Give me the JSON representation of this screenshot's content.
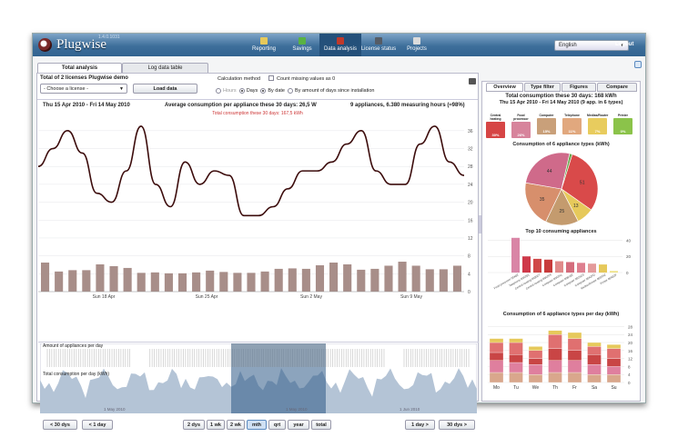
{
  "app": {
    "name": "Plugwise",
    "version": "1.4.0.1031"
  },
  "nav": [
    {
      "label": "Reporting",
      "icon": "reporting-icon",
      "color": "#e6c95b"
    },
    {
      "label": "Savings",
      "icon": "savings-icon",
      "color": "#59b243"
    },
    {
      "label": "Data analysis",
      "icon": "data-analysis-icon",
      "color": "#c0392b"
    },
    {
      "label": "License status",
      "icon": "license-icon",
      "color": "#555c66"
    },
    {
      "label": "Projects",
      "icon": "projects-icon",
      "color": "#dcdcdc"
    }
  ],
  "language": "English",
  "logout": "Logout",
  "tabs": [
    "Total analysis",
    "Log data table"
  ],
  "left": {
    "title": "Total of 2 licenses Plugwise demo",
    "license_select": "- Choose a license -",
    "load_button": "Load data",
    "calc_label": "Calculation method",
    "count_missing": "Count missing values as 0",
    "radios": [
      "Hours",
      "Days",
      "By date",
      "By amount of days since installation"
    ],
    "date_range": "Thu 15 Apr 2010 - Fri 14 May 2010",
    "avg": "Average consumption per appliance these 30 days: 26,5 W",
    "info": "9 appliances, 6.380 measuring hours (≈98%)",
    "sub": "Total consumption these 30 days: 167,5 kWh",
    "appliances_label": "Amount of appliances per day",
    "total_label": "Total consumption per day (kWh)",
    "overview_months": [
      "1 May 2010",
      "1 May 2010",
      "1 Jun 2010"
    ],
    "buttons_left": [
      "< 30 dys",
      "< 1 day"
    ],
    "periods": [
      "2 dys",
      "1 wk",
      "2 wk",
      "mth",
      "qrt",
      "year",
      "total"
    ],
    "selected_period": "mth",
    "buttons_right": [
      "1 day >",
      "30 dys >"
    ]
  },
  "chart_data": [
    {
      "type": "line",
      "yticks": [
        0,
        4,
        8,
        12,
        16,
        20,
        24,
        28,
        32,
        36
      ],
      "ylim": [
        0,
        38
      ],
      "x_tick_labels": [
        "Sun 18 Apr",
        "Sun 25 Apr",
        "Sun 2 May",
        "Sun 9 May"
      ],
      "values": [
        28,
        32,
        36,
        31,
        22,
        20,
        27,
        37,
        24,
        19,
        29,
        24,
        27,
        26,
        17,
        17,
        19,
        23,
        27,
        27,
        29,
        33,
        36,
        27,
        24,
        24,
        33,
        37,
        29,
        26
      ],
      "daily_bars": [
        6.5,
        4.5,
        4.8,
        4.8,
        6.1,
        5.7,
        5.3,
        4.2,
        4.3,
        4.1,
        4.1,
        4.3,
        4.7,
        4.4,
        4.2,
        4.2,
        4.5,
        5.1,
        5.2,
        5.1,
        5.9,
        6.5,
        6.1,
        4.9,
        5.1,
        5.8,
        6.7,
        5.8,
        5.0,
        5.0,
        5.8
      ],
      "bar_color": "#a88e89",
      "line_color": "#3c0c0c"
    },
    {
      "type": "pie",
      "title": "Consumption of 6 appliance types (kWh)",
      "labels": [
        "Central heating",
        "Food processing",
        "Computer",
        "Telephone",
        "Medias/Router",
        "Printer"
      ],
      "values": [
        51,
        13,
        25,
        35,
        44,
        2
      ],
      "colors": [
        "#d94a4a",
        "#e6c95b",
        "#c49b6e",
        "#d78f6c",
        "#cf6a8a",
        "#6aa84f"
      ]
    },
    {
      "type": "bar",
      "title": "Top 10 consuming appliances",
      "categories": [
        "Food processor 00AB2",
        "Telephone 00A2B1",
        "Central heating 0030C7",
        "Central heating 00A2F9",
        "Computer 00A2A1",
        "Computer 00B1B2",
        "Computer 00C5C0",
        "Computer 00A2FD",
        "Medias/Router 00D2A2",
        "Printer 00AB2F"
      ],
      "values": [
        43,
        20,
        17,
        16,
        14,
        13,
        12,
        11,
        10,
        2
      ],
      "colors": [
        "#d985a6",
        "#cf3a4a",
        "#d04848",
        "#c83b3b",
        "#e08a8a",
        "#d46c7c",
        "#de7f8f",
        "#e49a9a",
        "#e6c95b",
        "#efe38a"
      ],
      "yticks": [
        0,
        20,
        40
      ]
    },
    {
      "type": "bar",
      "title": "Consumption of 6 appliance types per day (kWh)",
      "categories": [
        "Mo",
        "Tu",
        "We",
        "Th",
        "Fr",
        "Sa",
        "Su"
      ],
      "series": [
        {
          "name": "Medias/Router",
          "values": [
            5,
            5,
            4,
            5,
            5,
            4,
            4
          ],
          "color": "#d9a78c"
        },
        {
          "name": "Telephone",
          "values": [
            6,
            5,
            5,
            6,
            6,
            5,
            4
          ],
          "color": "#df7f9e"
        },
        {
          "name": "Computer",
          "values": [
            4,
            4,
            3,
            6,
            5,
            5,
            4
          ],
          "color": "#c94545"
        },
        {
          "name": "Central heating",
          "values": [
            5,
            6,
            4,
            7,
            6,
            4,
            5
          ],
          "color": "#e07070"
        },
        {
          "name": "Food processing",
          "values": [
            2,
            2,
            2,
            2,
            3,
            2,
            2
          ],
          "color": "#e6c95b"
        }
      ],
      "yticks": [
        0,
        4,
        8,
        12,
        16,
        20,
        24,
        28
      ]
    }
  ],
  "right": {
    "tabs": [
      "Overview",
      "Type filter",
      "Figures",
      "Compare"
    ],
    "head1": "Total consumption these 30 days: 168 kWh",
    "head2": "Thu 15 Apr 2010 - Fri 14 May 2010 (9 app. in 6 types)",
    "appliances": [
      {
        "name": "Central heating",
        "pct": "30%",
        "color": "#d64545"
      },
      {
        "name": "Food processor",
        "pct": "26%",
        "color": "#d7849c"
      },
      {
        "name": "Computer",
        "pct": "15%",
        "color": "#c9a07a"
      },
      {
        "name": "Telephone",
        "pct": "11%",
        "color": "#e1a87e"
      },
      {
        "name": "Medias/Router",
        "pct": "7%",
        "color": "#e8cc5e"
      },
      {
        "name": "Printer",
        "pct": "0%",
        "color": "#8bc34a"
      }
    ]
  }
}
